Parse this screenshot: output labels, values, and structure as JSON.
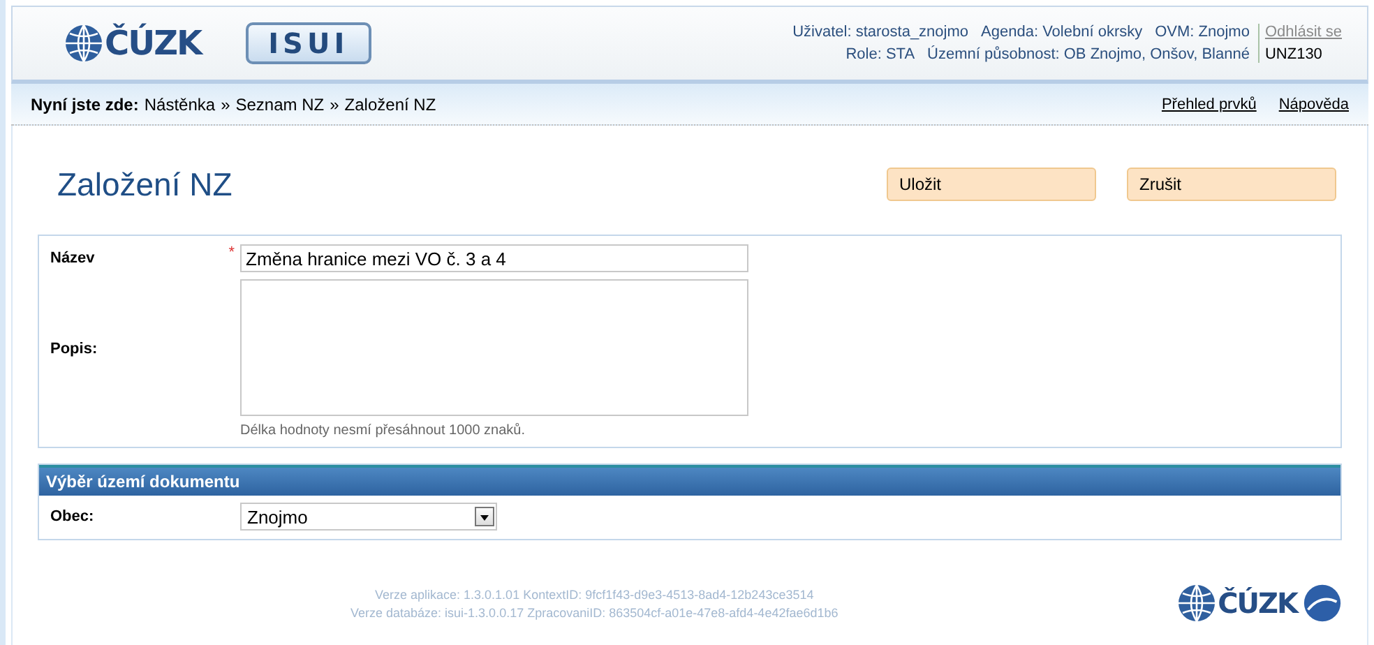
{
  "header": {
    "logo": "ČÚZK",
    "app_logo": "ISUI",
    "user_info": [
      [
        "Uživatel: starosta_znojmo",
        "Agenda: Volební okrsky",
        "OVM: Znojmo"
      ],
      [
        "Role: STA",
        "Územní působnost: OB Znojmo, Onšov, Blanné"
      ]
    ],
    "logout": "Odhlásit se",
    "code": "UNZ130"
  },
  "breadcrumb": {
    "label": "Nyní jste zde:",
    "separator": "»",
    "items": [
      "Nástěnka",
      "Seznam NZ",
      "Založení NZ"
    ]
  },
  "links": [
    "Přehled prvků",
    "Nápověda"
  ],
  "page": {
    "title": "Založení NZ",
    "buttons": [
      "Uložit",
      "Zrušit"
    ]
  },
  "form": {
    "fields": [
      {
        "kind": "text",
        "label": "Název",
        "required_mark": "*",
        "value": "Změna hranice mezi VO č. 3 a 4"
      },
      {
        "kind": "textarea",
        "label": "Popis:",
        "hint": "Délka hodnoty nesmí přesáhnout 1000 znaků."
      }
    ]
  },
  "section": {
    "title": "Výběr území dokumentu",
    "fields": [
      {
        "kind": "select",
        "label": "Obec:",
        "value": "Znojmo"
      }
    ]
  },
  "footer": {
    "lines": [
      "Verze aplikace: 1.3.0.1.01 KontextID: 9fcf1f43-d9e3-4513-8ad4-12b243ce3514",
      "Verze databáze: isui-1.3.0.0.17 ZpracovaniID: 863504cf-a01e-47e8-afd4-4e42fae6d1b6"
    ],
    "logo": "ČÚZK"
  }
}
